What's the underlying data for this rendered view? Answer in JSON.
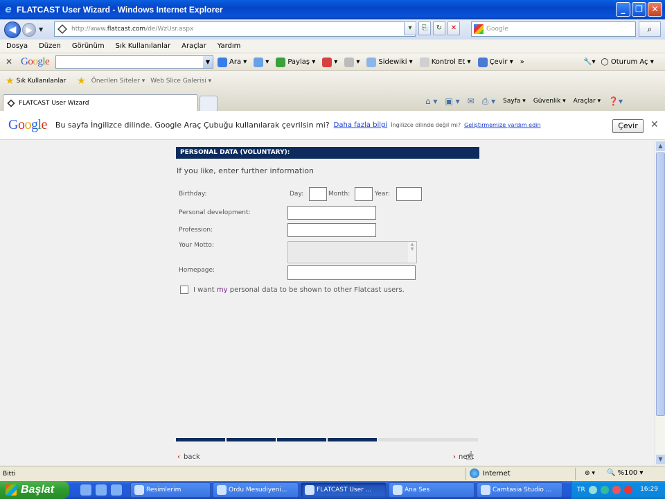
{
  "window": {
    "title": "FLATCAST User Wizard - Windows Internet Explorer",
    "buttons": [
      "_",
      "❐",
      "✕"
    ]
  },
  "address": {
    "url_prefix": "http://www.",
    "url_domain": "flatcast.com",
    "url_path": "/de/WzUsr.aspx",
    "search_placeholder": "Google"
  },
  "menu": [
    "Dosya",
    "Düzen",
    "Görünüm",
    "Sık Kullanılanlar",
    "Araçlar",
    "Yardım"
  ],
  "google_toolbar": {
    "logo": "Google",
    "search_btn": "Ara",
    "tools": [
      "Paylaş",
      "Sidewiki",
      "Kontrol Et",
      "Çevir"
    ],
    "more": "»",
    "signin": "Oturum Aç"
  },
  "favorites": {
    "label": "Sık Kullanılanlar",
    "items": [
      "Önerilen Siteler",
      "Web Slice Galerisi"
    ]
  },
  "tab": {
    "title": "FLATCAST User Wizard"
  },
  "command_bar": [
    "Sayfa",
    "Güvenlik",
    "Araçlar"
  ],
  "translate_bar": {
    "logo": "Google",
    "message": "Bu sayfa İngilizce dilinde. Google Araç Çubuğu kullanılarak çevrilsin mi?",
    "more_info": "Daha fazla bilgi",
    "not_english": "İngilizce dilinde değil mi?",
    "help_improve": "Geliştirmemize yardım edin",
    "translate_btn": "Çevir",
    "close": "✕"
  },
  "form": {
    "section_title": "PERSONAL DATA (VOLUNTARY):",
    "intro": "If you like, enter further information",
    "birthday_label": "Birthday:",
    "day_label": "Day:",
    "month_label": "Month:",
    "year_label": "Year:",
    "personal_dev_label": "Personal development:",
    "profession_label": "Profession:",
    "motto_label": "Your Motto:",
    "homepage_label": "Homepage:",
    "consent_pre": "I want ",
    "consent_hl": "my",
    "consent_post": " personal data to be shown to other Flatcast users.",
    "consent_checked": false,
    "progress_steps_done": 4,
    "back": "back",
    "next": "next"
  },
  "status": {
    "text": "Bitti",
    "zone": "Internet",
    "zoom": "%100"
  },
  "taskbar": {
    "start": "Başlat",
    "buttons": [
      "Resimlerim",
      "Ordu Mesudiyeni...",
      "FLATCAST User ...",
      "Ana Ses",
      "Camtasia Studio ..."
    ],
    "active_index": 2,
    "lang": "TR",
    "clock": "16:29"
  }
}
